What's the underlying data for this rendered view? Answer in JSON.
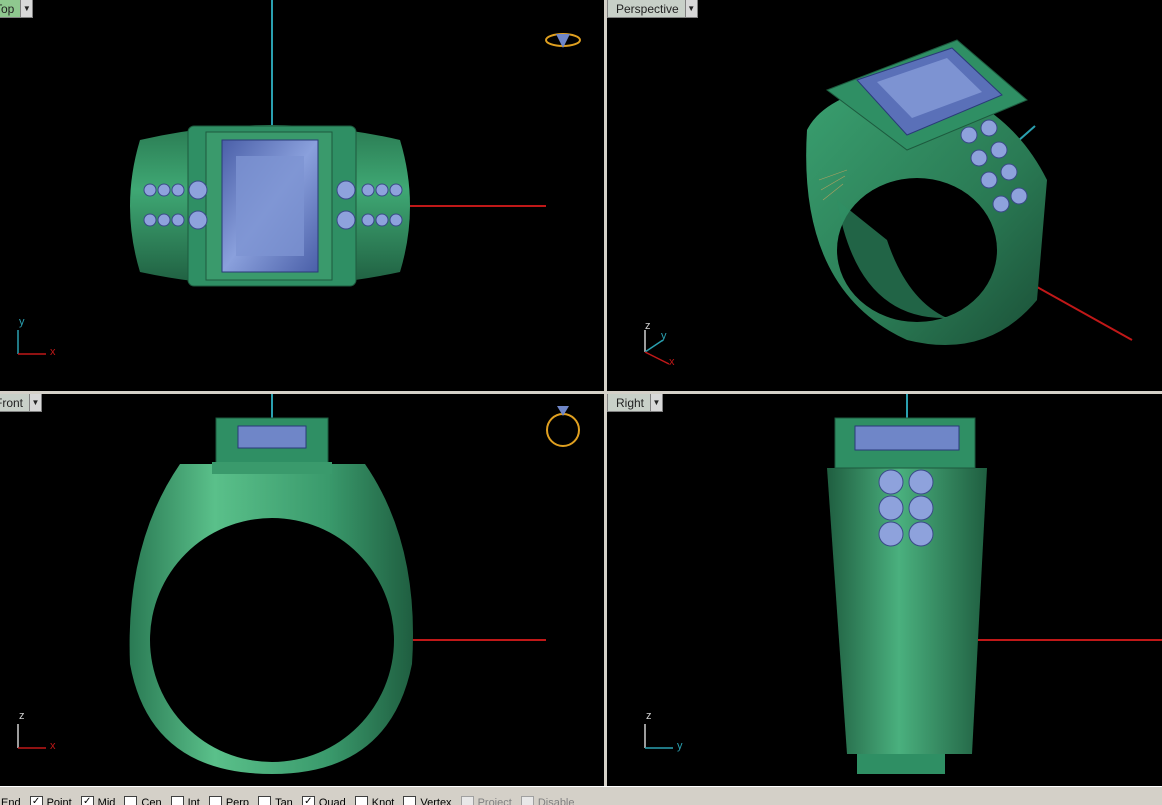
{
  "viewports": {
    "top": {
      "label": "Top"
    },
    "perspective": {
      "label": "Perspective"
    },
    "front": {
      "label": "Front"
    },
    "right": {
      "label": "Right"
    }
  },
  "axes": {
    "x": "x",
    "y": "y",
    "z": "z"
  },
  "snaps": [
    {
      "label": "End",
      "checked": true,
      "enabled": true
    },
    {
      "label": "Point",
      "checked": true,
      "enabled": true
    },
    {
      "label": "Mid",
      "checked": true,
      "enabled": true
    },
    {
      "label": "Cen",
      "checked": false,
      "enabled": true
    },
    {
      "label": "Int",
      "checked": false,
      "enabled": true
    },
    {
      "label": "Perp",
      "checked": false,
      "enabled": true
    },
    {
      "label": "Tan",
      "checked": false,
      "enabled": true
    },
    {
      "label": "Quad",
      "checked": true,
      "enabled": true
    },
    {
      "label": "Knot",
      "checked": false,
      "enabled": true
    },
    {
      "label": "Vertex",
      "checked": false,
      "enabled": true
    },
    {
      "label": "Project",
      "checked": false,
      "enabled": false
    },
    {
      "label": "Disable",
      "checked": false,
      "enabled": false
    }
  ],
  "colors": {
    "metal": "#2f8f64",
    "gem": "#6f86c8",
    "axis_x": "#c01818",
    "axis_y": "#2aa0b0",
    "border": "#c0c0c0"
  }
}
